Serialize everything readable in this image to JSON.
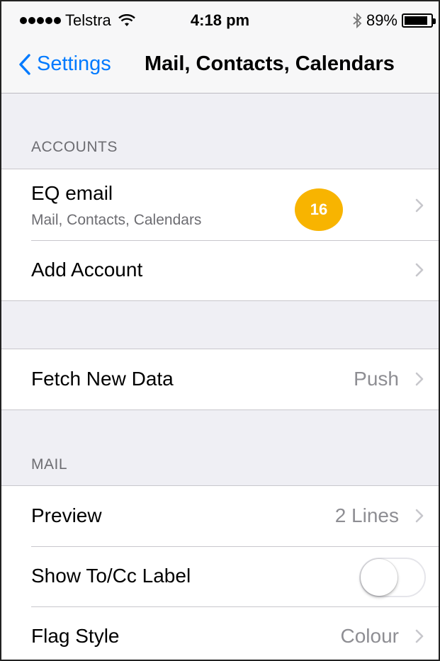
{
  "status_bar": {
    "carrier": "Telstra",
    "time": "4:18 pm",
    "battery_percent": "89%",
    "battery_level": 0.89,
    "icons": [
      "signal-dots-icon",
      "wifi-icon",
      "bluetooth-icon",
      "battery-icon"
    ]
  },
  "nav": {
    "back_label": "Settings",
    "title": "Mail, Contacts, Calendars",
    "accent_color": "#007aff"
  },
  "accounts": {
    "header": "ACCOUNTS",
    "items": [
      {
        "label": "EQ email",
        "subtitle": "Mail, Contacts, Calendars"
      },
      {
        "label": "Add Account"
      }
    ],
    "badge": {
      "text": "16",
      "color": "#f8b400"
    }
  },
  "fetch": {
    "label": "Fetch New Data",
    "value": "Push"
  },
  "mail": {
    "header": "MAIL",
    "items": [
      {
        "label": "Preview",
        "value": "2 Lines"
      },
      {
        "label": "Show To/Cc Label",
        "toggle_on": false
      },
      {
        "label": "Flag Style",
        "value": "Colour"
      }
    ]
  }
}
